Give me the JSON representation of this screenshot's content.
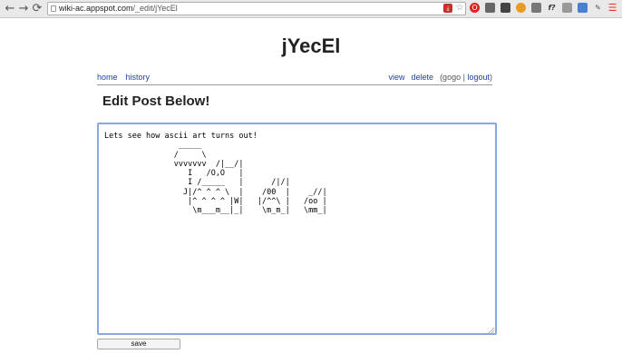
{
  "browser": {
    "url_host": "wiki-ac.appspot.com",
    "url_path": "/_edit/jYecEl",
    "back_icon": "←",
    "forward_icon": "→",
    "reload_icon": "⟳",
    "star_icon": "☆",
    "settings_icon": "☰",
    "ext1_icon": "A",
    "ext2_icon": "O",
    "ext5_icon": "f?"
  },
  "page": {
    "title": "jYecEl",
    "heading": "Edit Post Below!",
    "save_label": "save"
  },
  "nav": {
    "home": "home",
    "history": "history",
    "view": "view",
    "delete": "delete",
    "user_open": "(gogo",
    "separator": "|",
    "logout": "logout",
    "user_close": ")"
  },
  "editor": {
    "content": "Lets see how ascii art turns out!\n                _____\n               /     \\\n               vvvvvvv  /|__/|\n                  I   /O,O   |\n                  I /_____   |      /|/|\n                 J|/^ ^ ^ \\  |    /00  |    _//|\n                  |^ ^ ^ ^ |W|   |/^^\\ |   /oo |\n                   \\m___m__|_|    \\m_m_|   \\mm_|"
  },
  "colors": {
    "link": "#1f3fa8",
    "focus_border": "#86a9e0"
  }
}
